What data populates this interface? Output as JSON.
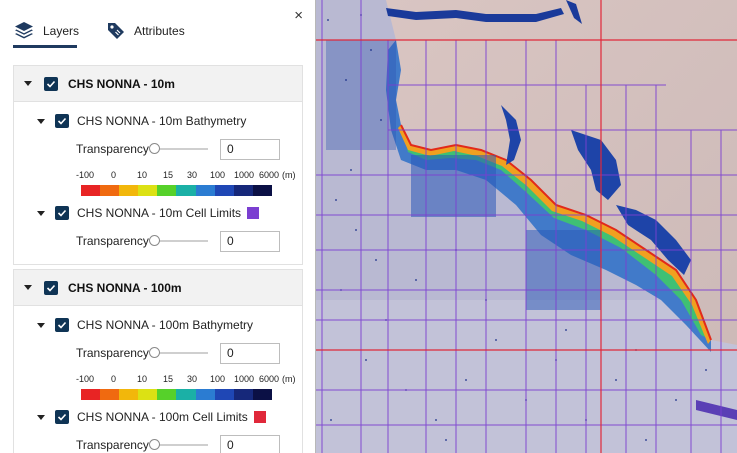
{
  "panel": {
    "tabs": [
      {
        "label": "Layers",
        "icon": "layers-icon"
      },
      {
        "label": "Attributes",
        "icon": "tag-icon"
      }
    ],
    "close_label": "×"
  },
  "groups": [
    {
      "title": "CHS NONNA - 10m",
      "layers": [
        {
          "name": "CHS NONNA - 10m Bathymetry",
          "transparency_label": "Transparency",
          "transparency_value": "0",
          "slider_fraction": 0
        },
        {
          "name": "CHS NONNA - 10m Cell Limits",
          "swatch_color": "#7b3fd1",
          "transparency_label": "Transparency",
          "transparency_value": "0",
          "slider_fraction": 0
        }
      ]
    },
    {
      "title": "CHS NONNA - 100m",
      "layers": [
        {
          "name": "CHS NONNA - 100m Bathymetry",
          "transparency_label": "Transparency",
          "transparency_value": "0",
          "slider_fraction": 0
        },
        {
          "name": "CHS NONNA - 100m Cell Limits",
          "swatch_color": "#e0283a",
          "transparency_label": "Transparency",
          "transparency_value": "0",
          "slider_fraction": 0
        }
      ]
    }
  ],
  "legend": {
    "labels": [
      "-100",
      "0",
      "10",
      "15",
      "30",
      "100",
      "1000",
      "6000",
      "(m)"
    ],
    "colors": [
      "#e82424",
      "#f06a10",
      "#f2b70b",
      "#dce114",
      "#56d12a",
      "#1bb0a6",
      "#2b7cd2",
      "#1f47b5",
      "#16287a",
      "#0b1045"
    ]
  },
  "colors": {
    "accent": "#1f3a5f",
    "checkbox": "#0f3455",
    "grid_10m": "#7b3fd1",
    "grid_100m": "#e0283a"
  }
}
